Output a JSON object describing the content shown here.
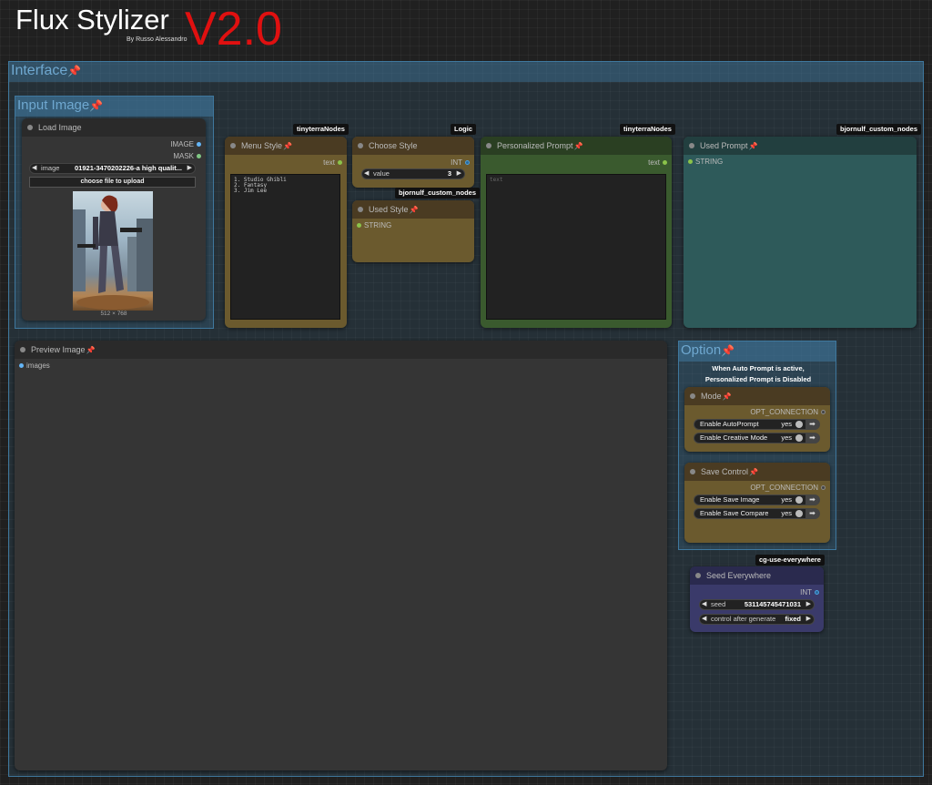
{
  "header": {
    "title": "Flux Stylizer",
    "version": "V2.0",
    "byline": "By Russo Alessandro"
  },
  "groups": {
    "interface": "Interface",
    "input_image": "Input Image",
    "option": "Option",
    "option_note_line1": "When Auto Prompt is active,",
    "option_note_line2": "Personalized Prompt is Disabled"
  },
  "load_image": {
    "title": "Load Image",
    "out_image": "IMAGE",
    "out_mask": "MASK",
    "widget_label": "image",
    "widget_value": "01921-3470202226-a high qualit...",
    "upload_label": "choose file to upload",
    "image_size": "512 × 768"
  },
  "menu_style": {
    "badge": "tinyterraNodes",
    "title": "Menu Style",
    "out": "text",
    "text": "1. Studio Ghibli\n2. Fantasy\n3. Jim Lee"
  },
  "choose_style": {
    "badge": "Logic",
    "title": "Choose Style",
    "out": "INT",
    "widget_label": "value",
    "widget_value": "3"
  },
  "used_style": {
    "badge": "bjornulf_custom_nodes",
    "title": "Used Style",
    "in": "STRING"
  },
  "personalized_prompt": {
    "badge": "tinyterraNodes",
    "title": "Personalized Prompt",
    "out": "text",
    "placeholder": "text"
  },
  "used_prompt": {
    "badge": "bjornulf_custom_nodes",
    "title": "Used Prompt",
    "in": "STRING"
  },
  "preview_image": {
    "title": "Preview Image",
    "in": "images"
  },
  "mode": {
    "title": "Mode",
    "out": "OPT_CONNECTION",
    "toggles": [
      {
        "label": "Enable AutoPrompt",
        "value": "yes"
      },
      {
        "label": "Enable Creative Mode",
        "value": "yes"
      }
    ]
  },
  "save_control": {
    "title": "Save Control",
    "out": "OPT_CONNECTION",
    "toggles": [
      {
        "label": "Enable Save Image",
        "value": "yes"
      },
      {
        "label": "Enable Save Compare",
        "value": "yes"
      }
    ]
  },
  "seed_everywhere": {
    "badge": "cg-use-everywhere",
    "title": "Seed Everywhere",
    "out": "INT",
    "seed_label": "seed",
    "seed_value": "531145745471031",
    "control_label": "control after generate",
    "control_value": "fixed"
  },
  "colors": {
    "group": "#3f789e",
    "brown_node": "#6b5a2e",
    "green_node": "#3a5a2e",
    "teal_node": "#2e5a5a",
    "purple_node": "#3a3a6a",
    "version_red": "#e01010"
  }
}
